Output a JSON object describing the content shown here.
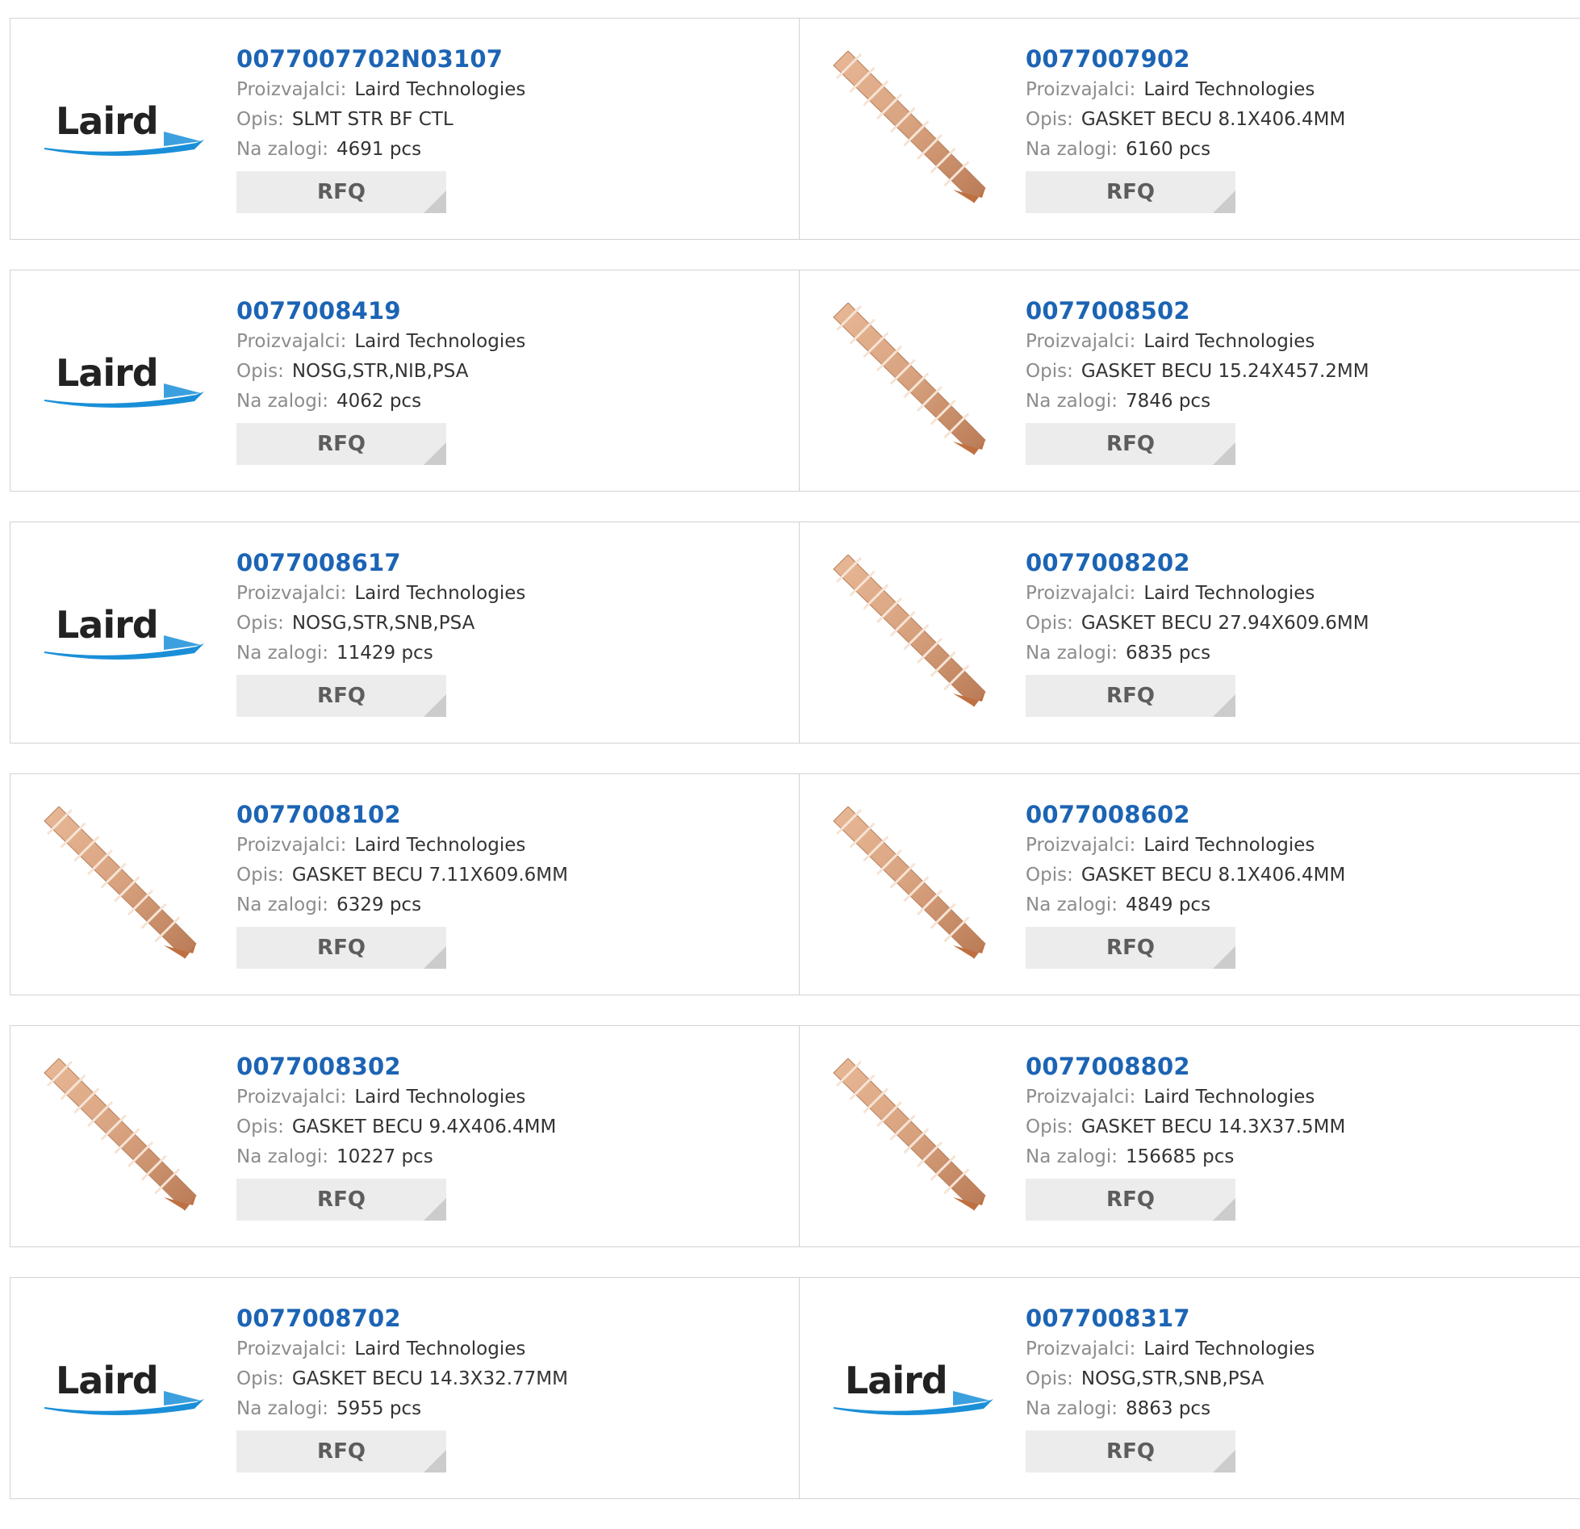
{
  "labels": {
    "manufacturer": "Proizvajalci:",
    "description": "Opis:",
    "stock": "Na zalogi:",
    "rfq": "RFQ"
  },
  "brand_logo_text": "Laird",
  "colors": {
    "link": "#1c64b4",
    "label": "#8c8c8c",
    "value": "#333333",
    "button_bg": "#ececec",
    "copper": "#d8a27f",
    "logo_swoosh": "#1a8fd8"
  },
  "rows": [
    [
      {
        "part": "0077007702N03107",
        "manufacturer": "Laird Technologies",
        "description": "SLMT STR BF CTL",
        "stock": "4691 pcs",
        "image": "laird-logo"
      },
      {
        "part": "0077007902",
        "manufacturer": "Laird Technologies",
        "description": "GASKET BECU 8.1X406.4MM",
        "stock": "6160 pcs",
        "image": "gasket-strip"
      }
    ],
    [
      {
        "part": "0077008419",
        "manufacturer": "Laird Technologies",
        "description": "NOSG,STR,NIB,PSA",
        "stock": "4062 pcs",
        "image": "laird-logo"
      },
      {
        "part": "0077008502",
        "manufacturer": "Laird Technologies",
        "description": "GASKET BECU 15.24X457.2MM",
        "stock": "7846 pcs",
        "image": "gasket-strip"
      }
    ],
    [
      {
        "part": "0077008617",
        "manufacturer": "Laird Technologies",
        "description": "NOSG,STR,SNB,PSA",
        "stock": "11429 pcs",
        "image": "laird-logo"
      },
      {
        "part": "0077008202",
        "manufacturer": "Laird Technologies",
        "description": "GASKET BECU 27.94X609.6MM",
        "stock": "6835 pcs",
        "image": "gasket-strip"
      }
    ],
    [
      {
        "part": "0077008102",
        "manufacturer": "Laird Technologies",
        "description": "GASKET BECU 7.11X609.6MM",
        "stock": "6329 pcs",
        "image": "gasket-strip"
      },
      {
        "part": "0077008602",
        "manufacturer": "Laird Technologies",
        "description": "GASKET BECU 8.1X406.4MM",
        "stock": "4849 pcs",
        "image": "gasket-strip"
      }
    ],
    [
      {
        "part": "0077008302",
        "manufacturer": "Laird Technologies",
        "description": "GASKET BECU 9.4X406.4MM",
        "stock": "10227 pcs",
        "image": "gasket-strip"
      },
      {
        "part": "0077008802",
        "manufacturer": "Laird Technologies",
        "description": "GASKET BECU 14.3X37.5MM",
        "stock": "156685 pcs",
        "image": "gasket-strip"
      }
    ],
    [
      {
        "part": "0077008702",
        "manufacturer": "Laird Technologies",
        "description": "GASKET BECU 14.3X32.77MM",
        "stock": "5955 pcs",
        "image": "laird-logo"
      },
      {
        "part": "0077008317",
        "manufacturer": "Laird Technologies",
        "description": "NOSG,STR,SNB,PSA",
        "stock": "8863 pcs",
        "image": "laird-logo"
      }
    ]
  ]
}
